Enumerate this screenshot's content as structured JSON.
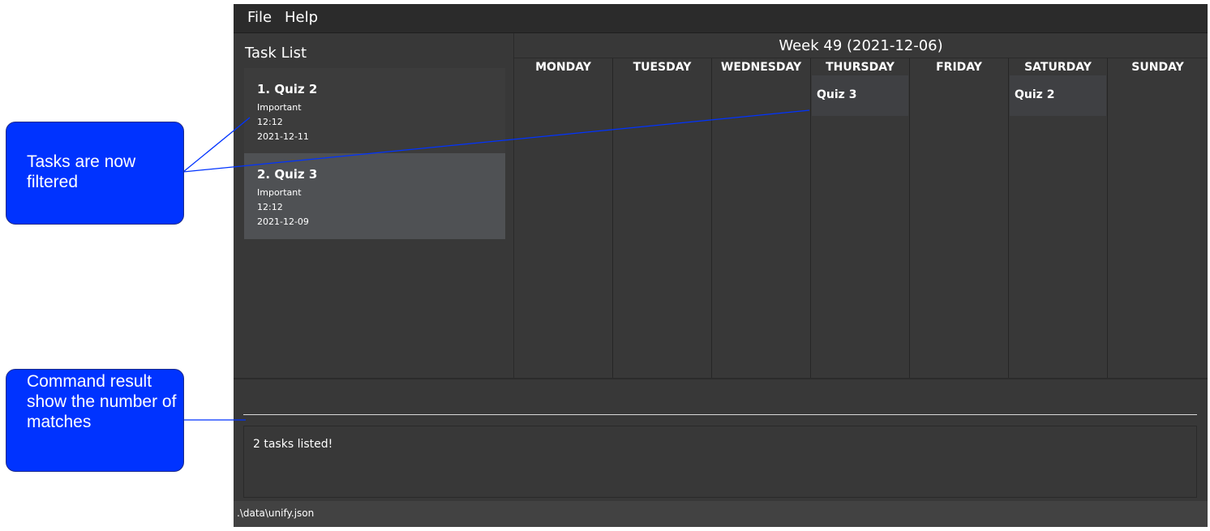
{
  "menu": {
    "file": "File",
    "help": "Help"
  },
  "task_list": {
    "title": "Task List",
    "tasks": [
      {
        "name": "1.  Quiz 2",
        "tag": "Important",
        "time": "12:12",
        "date": "2021-12-11"
      },
      {
        "name": "2.  Quiz 3",
        "tag": "Important",
        "time": "12:12",
        "date": "2021-12-09"
      }
    ]
  },
  "calendar": {
    "week_title": "Week 49 (2021-12-06)",
    "days": [
      {
        "name": "MONDAY",
        "event": ""
      },
      {
        "name": "TUESDAY",
        "event": ""
      },
      {
        "name": "WEDNESDAY",
        "event": ""
      },
      {
        "name": "THURSDAY",
        "event": "Quiz 3"
      },
      {
        "name": "FRIDAY",
        "event": ""
      },
      {
        "name": "SATURDAY",
        "event": "Quiz 2"
      },
      {
        "name": "SUNDAY",
        "event": ""
      }
    ]
  },
  "command": {
    "value": ""
  },
  "result": {
    "text": "2 tasks listed!"
  },
  "status": {
    "file_path": ".\\data\\unify.json"
  },
  "annotations": {
    "callout_1": "Tasks are now filtered",
    "callout_2": "Command result show the number of matches"
  },
  "colors": {
    "callout_fill": "#0033ff",
    "app_background": "#383838"
  }
}
